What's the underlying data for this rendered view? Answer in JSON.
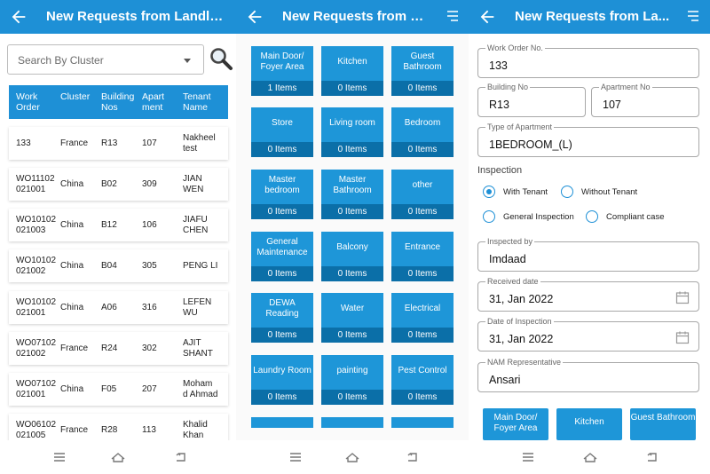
{
  "colors": {
    "primary": "#1e90d6",
    "tile": "#1e96d8",
    "tile_count_bg": "#0b6fa8"
  },
  "panel1": {
    "title": "New Requests from Landlo...",
    "search": {
      "placeholder": "Search By Cluster"
    },
    "table": {
      "headers": [
        "Work Order",
        "Cluster",
        "Building Nos",
        "Apartment",
        "Tenant Name"
      ],
      "rows": [
        [
          "133",
          "France",
          "R13",
          "107",
          "Nakheel test"
        ],
        [
          "WO11102021001",
          "China",
          "B02",
          "309",
          "JIAN WEN"
        ],
        [
          "WO10102021003",
          "China",
          "B12",
          "106",
          "JIAFU CHEN"
        ],
        [
          "WO10102021002",
          "China",
          "B04",
          "305",
          "PENG LI"
        ],
        [
          "WO10102021001",
          "China",
          "A06",
          "316",
          "LEFEN WU"
        ],
        [
          "WO07102021002",
          "France",
          "R24",
          "302",
          "AJIT SHANT"
        ],
        [
          "WO07102021001",
          "China",
          "F05",
          "207",
          "Mohamad Ahmad"
        ],
        [
          "WO06102021005",
          "France",
          "R28",
          "113",
          "Khalid Khan"
        ]
      ],
      "display": {
        "headers": [
          [
            "Work",
            "Order"
          ],
          [
            "Cluster"
          ],
          [
            "Building",
            "Nos"
          ],
          [
            "Apart",
            "ment"
          ],
          [
            "Tenant",
            "Name"
          ]
        ],
        "rows": [
          [
            [
              "133"
            ],
            [
              "France"
            ],
            [
              "R13"
            ],
            [
              "107"
            ],
            [
              "Nakheel",
              "test"
            ]
          ],
          [
            [
              "WO11102",
              "021001"
            ],
            [
              "China"
            ],
            [
              "B02"
            ],
            [
              "309"
            ],
            [
              "JIAN",
              "WEN"
            ]
          ],
          [
            [
              "WO10102",
              "021003"
            ],
            [
              "China"
            ],
            [
              "B12"
            ],
            [
              "106"
            ],
            [
              "JIAFU",
              "CHEN"
            ]
          ],
          [
            [
              "WO10102",
              "021002"
            ],
            [
              "China"
            ],
            [
              "B04"
            ],
            [
              "305"
            ],
            [
              "PENG LI"
            ]
          ],
          [
            [
              "WO10102",
              "021001"
            ],
            [
              "China"
            ],
            [
              "A06"
            ],
            [
              "316"
            ],
            [
              "LEFEN",
              "WU"
            ]
          ],
          [
            [
              "WO07102",
              "021002"
            ],
            [
              "France"
            ],
            [
              "R24"
            ],
            [
              "302"
            ],
            [
              "AJIT",
              "SHANT"
            ]
          ],
          [
            [
              "WO07102",
              "021001"
            ],
            [
              "China"
            ],
            [
              "F05"
            ],
            [
              "207"
            ],
            [
              "Moham",
              "d Ahmad"
            ]
          ],
          [
            [
              "WO06102",
              "021005"
            ],
            [
              "France"
            ],
            [
              "R28"
            ],
            [
              "113"
            ],
            [
              "Khalid",
              "Khan"
            ]
          ]
        ]
      }
    }
  },
  "panel2": {
    "title": "New Requests from La...",
    "tiles": [
      {
        "label": "Main Door/ Foyer Area",
        "count": "1 Items"
      },
      {
        "label": "Kitchen",
        "count": "0 Items"
      },
      {
        "label": "Guest Bathroom",
        "count": "0 Items"
      },
      {
        "label": "Store",
        "count": "0 Items"
      },
      {
        "label": "Living room",
        "count": "0 Items"
      },
      {
        "label": "Bedroom",
        "count": "0 Items"
      },
      {
        "label": "Master bedroom",
        "count": "0 Items"
      },
      {
        "label": "Master Bathroom",
        "count": "0 Items"
      },
      {
        "label": "other",
        "count": "0 Items"
      },
      {
        "label": "General Maintenance",
        "count": "0 Items"
      },
      {
        "label": "Balcony",
        "count": "0 Items"
      },
      {
        "label": "Entrance",
        "count": "0 Items"
      },
      {
        "label": "DEWA Reading",
        "count": "0 Items"
      },
      {
        "label": "Water",
        "count": "0 Items"
      },
      {
        "label": "Electrical",
        "count": "0 Items"
      },
      {
        "label": "Laundry Room",
        "count": "0 Items"
      },
      {
        "label": "painting",
        "count": "0 Items"
      },
      {
        "label": "Pest Control",
        "count": "0 Items"
      }
    ]
  },
  "panel3": {
    "title": "New Requests from La...",
    "fields": {
      "work_order": {
        "label": "Work Order No.",
        "value": "133"
      },
      "building": {
        "label": "Building No",
        "value": "R13"
      },
      "apartment": {
        "label": "Apartment No",
        "value": "107"
      },
      "apt_type": {
        "label": "Type of Apartment",
        "value": "1BEDROOM_(L)"
      },
      "inspected_by": {
        "label": "Inspected by",
        "value": "Imdaad"
      },
      "received_date": {
        "label": "Received date",
        "value": "31, Jan 2022"
      },
      "inspection_date": {
        "label": "Date of Inspection",
        "value": "31, Jan 2022"
      },
      "nam_rep": {
        "label": "NAM Representative",
        "value": "Ansari"
      }
    },
    "inspection": {
      "label": "Inspection",
      "options": [
        {
          "label": "With Tenant",
          "selected": true
        },
        {
          "label": "Without Tenant",
          "selected": false
        },
        {
          "label": "General Inspection",
          "selected": false
        },
        {
          "label": "Compliant case",
          "selected": false
        }
      ]
    },
    "buttons": [
      "Main Door/ Foyer Area",
      "Kitchen",
      "Guest Bathroom"
    ]
  }
}
